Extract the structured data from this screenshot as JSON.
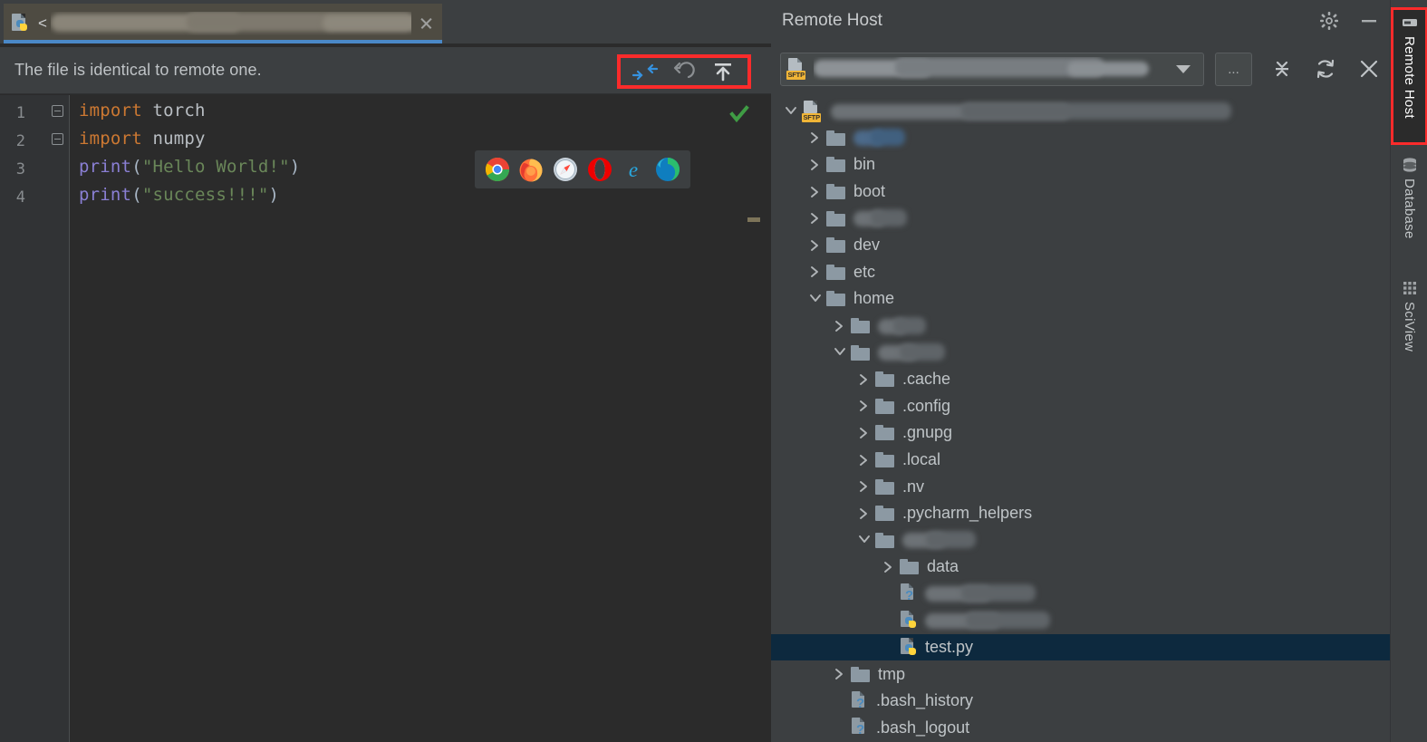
{
  "editor": {
    "tab": {
      "icon": "python-file-icon",
      "prefix": "<",
      "title_redacted": true,
      "close_icon": "close-icon"
    },
    "banner": {
      "message": "The file is identical to remote one.",
      "actions": [
        {
          "icon": "diff-compare-icon",
          "label": "Compare with remote"
        },
        {
          "icon": "undo-revert-icon",
          "label": "Revert"
        },
        {
          "icon": "upload-icon",
          "label": "Upload to remote"
        }
      ],
      "highlight_color": "#fb2b2b"
    },
    "line_numbers": [
      "1",
      "2",
      "3",
      "4"
    ],
    "code_lines": [
      {
        "n": "1",
        "tokens": [
          {
            "t": "import",
            "c": "kw"
          },
          {
            "t": " ",
            "c": "punc"
          },
          {
            "t": "torch",
            "c": "ident"
          }
        ]
      },
      {
        "n": "2",
        "tokens": [
          {
            "t": "import",
            "c": "kw"
          },
          {
            "t": " ",
            "c": "punc"
          },
          {
            "t": "numpy",
            "c": "ident"
          }
        ]
      },
      {
        "n": "3",
        "tokens": [
          {
            "t": "print",
            "c": "fn"
          },
          {
            "t": "(",
            "c": "punc"
          },
          {
            "t": "\"Hello World!\"",
            "c": "str"
          },
          {
            "t": ")",
            "c": "punc"
          }
        ]
      },
      {
        "n": "4",
        "tokens": [
          {
            "t": "print",
            "c": "fn"
          },
          {
            "t": "(",
            "c": "punc"
          },
          {
            "t": "\"success!!!\"",
            "c": "str"
          },
          {
            "t": ")",
            "c": "punc"
          }
        ]
      }
    ],
    "inspection_status_icon": "green-checkmark-icon",
    "browser_popup": {
      "browsers": [
        {
          "name": "chrome-icon",
          "label": "Chrome"
        },
        {
          "name": "firefox-icon",
          "label": "Firefox"
        },
        {
          "name": "safari-icon",
          "label": "Safari"
        },
        {
          "name": "opera-icon",
          "label": "Opera"
        },
        {
          "name": "ie-icon",
          "label": "Internet Explorer"
        },
        {
          "name": "edge-icon",
          "label": "Edge"
        }
      ]
    }
  },
  "remote_host": {
    "title": "Remote Host",
    "header_actions": [
      {
        "icon": "gear-icon",
        "label": "Settings"
      },
      {
        "icon": "minimize-icon",
        "label": "Hide"
      }
    ],
    "connection_select": {
      "icon": "sftp-icon",
      "badge": "SFTP",
      "value_redacted": true,
      "value_tail": "...word",
      "caret": "chevron-down-icon"
    },
    "more_button": "...",
    "toolbar_actions": [
      {
        "icon": "collapse-all-icon",
        "label": "Collapse All"
      },
      {
        "icon": "refresh-icon",
        "label": "Refresh"
      },
      {
        "icon": "close-icon",
        "label": "Close"
      }
    ],
    "tree": [
      {
        "depth": 0,
        "twisty": "expanded",
        "icon": "sftp-root-icon",
        "label": "",
        "redacted": true,
        "rw": 480,
        "selected": false
      },
      {
        "depth": 1,
        "twisty": "collapsed",
        "icon": "folder",
        "label": "",
        "redacted": true,
        "rw": 62,
        "blue": true,
        "selected": false
      },
      {
        "depth": 1,
        "twisty": "collapsed",
        "icon": "folder",
        "label": "bin",
        "redacted": false,
        "selected": false
      },
      {
        "depth": 1,
        "twisty": "collapsed",
        "icon": "folder",
        "label": "boot",
        "redacted": false,
        "selected": false
      },
      {
        "depth": 1,
        "twisty": "collapsed",
        "icon": "folder",
        "label": "",
        "redacted": true,
        "rw": 64,
        "selected": false
      },
      {
        "depth": 1,
        "twisty": "collapsed",
        "icon": "folder",
        "label": "dev",
        "redacted": false,
        "selected": false
      },
      {
        "depth": 1,
        "twisty": "collapsed",
        "icon": "folder",
        "label": "etc",
        "redacted": false,
        "selected": false
      },
      {
        "depth": 1,
        "twisty": "expanded",
        "icon": "folder",
        "label": "home",
        "redacted": false,
        "selected": false
      },
      {
        "depth": 2,
        "twisty": "collapsed",
        "icon": "folder",
        "label": "",
        "redacted": true,
        "rw": 58,
        "selected": false
      },
      {
        "depth": 2,
        "twisty": "expanded",
        "icon": "folder",
        "label": "",
        "redacted": true,
        "rw": 80,
        "selected": false
      },
      {
        "depth": 3,
        "twisty": "collapsed",
        "icon": "folder",
        "label": ".cache",
        "redacted": false,
        "selected": false
      },
      {
        "depth": 3,
        "twisty": "collapsed",
        "icon": "folder",
        "label": ".config",
        "redacted": false,
        "selected": false
      },
      {
        "depth": 3,
        "twisty": "collapsed",
        "icon": "folder",
        "label": ".gnupg",
        "redacted": false,
        "selected": false
      },
      {
        "depth": 3,
        "twisty": "collapsed",
        "icon": "folder",
        "label": ".local",
        "redacted": false,
        "selected": false
      },
      {
        "depth": 3,
        "twisty": "collapsed",
        "icon": "folder",
        "label": ".nv",
        "redacted": false,
        "selected": false
      },
      {
        "depth": 3,
        "twisty": "collapsed",
        "icon": "folder",
        "label": ".pycharm_helpers",
        "redacted": false,
        "selected": false
      },
      {
        "depth": 3,
        "twisty": "expanded",
        "icon": "folder",
        "label": "",
        "redacted": true,
        "rw": 88,
        "selected": false
      },
      {
        "depth": 4,
        "twisty": "collapsed",
        "icon": "folder",
        "label": "data",
        "redacted": false,
        "selected": false
      },
      {
        "depth": 4,
        "twisty": "none",
        "icon": "file-unknown",
        "label": "",
        "redacted": true,
        "rw": 132,
        "selected": false
      },
      {
        "depth": 4,
        "twisty": "none",
        "icon": "file-python",
        "label": "",
        "redacted": true,
        "rw": 150,
        "selected": false
      },
      {
        "depth": 4,
        "twisty": "none",
        "icon": "file-python",
        "label": "test.py",
        "redacted": false,
        "selected": true
      },
      {
        "depth": 2,
        "twisty": "collapsed",
        "icon": "folder",
        "label": "tmp",
        "redacted": false,
        "selected": false
      },
      {
        "depth": 2,
        "twisty": "none",
        "icon": "file-unknown",
        "label": ".bash_history",
        "redacted": false,
        "selected": false
      },
      {
        "depth": 2,
        "twisty": "none",
        "icon": "file-unknown",
        "label": ".bash_logout",
        "redacted": false,
        "selected": false
      }
    ]
  },
  "tool_stripe": {
    "buttons": [
      {
        "name": "remote-host",
        "label": "Remote Host",
        "icon": "remote-host-icon",
        "active": true
      },
      {
        "name": "database",
        "label": "Database",
        "icon": "database-icon",
        "active": false
      },
      {
        "name": "sciview",
        "label": "SciView",
        "icon": "grid-icon",
        "active": false
      }
    ],
    "highlight_color": "#fb2b2b"
  }
}
